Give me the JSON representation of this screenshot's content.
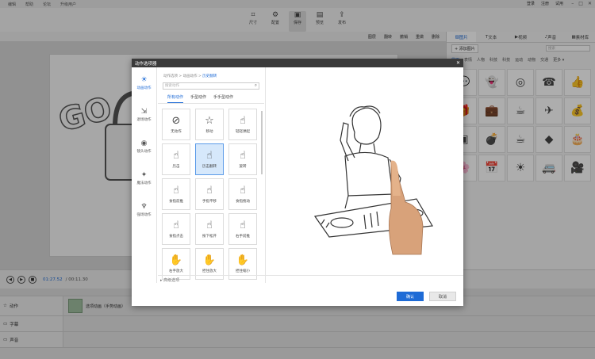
{
  "menubar": {
    "items": [
      "编辑",
      "帮助",
      "论坛",
      "升级用户"
    ],
    "right": [
      "登录",
      "注册",
      "试用"
    ]
  },
  "toolbar": {
    "buttons": [
      {
        "label": "尺寸",
        "icon": "crop-icon"
      },
      {
        "label": "配置",
        "icon": "gear-icon"
      },
      {
        "label": "保存",
        "icon": "save-icon"
      },
      {
        "label": "预览",
        "icon": "preview-icon"
      },
      {
        "label": "发布",
        "icon": "publish-icon"
      }
    ]
  },
  "subtoolbar": [
    "图层",
    "翻转",
    "撤销",
    "重做",
    "删除"
  ],
  "right_panel": {
    "tabs": [
      "图片",
      "文本",
      "视频",
      "声音",
      "素材库"
    ],
    "add_label": "+ 添加图片",
    "search_placeholder": "搜索",
    "categories": [
      "常用",
      "表情",
      "人物",
      "科技",
      "科技",
      "运动",
      "动物",
      "交通",
      "更多 ▾"
    ],
    "grid_icons": [
      "💬",
      "👻",
      "◎",
      "☎",
      "👍",
      "🎁",
      "💼",
      "☕",
      "✈",
      "💰",
      "▣",
      "💣",
      "☕",
      "◆",
      "🎂",
      "🌸",
      "📅",
      "☀",
      "🚐",
      "🎥"
    ]
  },
  "player": {
    "current_time": "01:27.52",
    "total_time": "/ 00:11.30"
  },
  "timeline": {
    "rows": [
      {
        "label": "动作",
        "clip": "选项动画（手势动画）"
      },
      {
        "label": "字幕",
        "clip": ""
      },
      {
        "label": "声音",
        "clip": ""
      }
    ]
  },
  "dialog": {
    "title": "动作选项器",
    "close": "✕",
    "sidebar": [
      {
        "label": "动画动作",
        "icon": "sun-icon",
        "active": true
      },
      {
        "label": "退场动作",
        "icon": "exit-icon",
        "active": false
      },
      {
        "label": "镜头动作",
        "icon": "camera-icon",
        "active": false
      },
      {
        "label": "魔法动作",
        "icon": "magic-icon",
        "active": false
      },
      {
        "label": "强场动作",
        "icon": "horn-icon",
        "active": false
      }
    ],
    "breadcrumb": {
      "path": "动作选项 > 动画动作 >",
      "current": "历史翻转"
    },
    "search_placeholder": "搜索动作",
    "subtabs": [
      "所有动作",
      "手型动作",
      "手手型动作"
    ],
    "actions": [
      {
        "label": "无动作",
        "icon": "⊘"
      },
      {
        "label": "移动",
        "icon": "☆"
      },
      {
        "label": "轻轻弹起",
        "icon": "☝"
      },
      {
        "label": "历击",
        "icon": "☝"
      },
      {
        "label": "历击翻转",
        "icon": "☝"
      },
      {
        "label": "旋转",
        "icon": "☝"
      },
      {
        "label": "食指前推",
        "icon": "☝"
      },
      {
        "label": "手指平移",
        "icon": "☝"
      },
      {
        "label": "食指拖动",
        "icon": "☝"
      },
      {
        "label": "食指点击",
        "icon": "☝"
      },
      {
        "label": "按下松开",
        "icon": "☝"
      },
      {
        "label": "右手前推",
        "icon": "☝"
      },
      {
        "label": "右手放大",
        "icon": "✋"
      },
      {
        "label": "捏住放大",
        "icon": "✋"
      },
      {
        "label": "捏住缩小",
        "icon": "✋"
      }
    ],
    "advanced": "▸ 高级选项",
    "ok": "确认",
    "cancel": "取消"
  }
}
